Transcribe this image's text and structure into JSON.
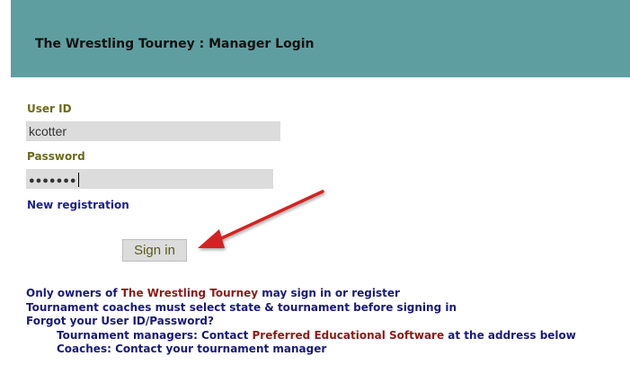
{
  "header": {
    "title": "The Wrestling Tourney : Manager Login"
  },
  "form": {
    "user_id_label": "User ID",
    "user_id_value": "kcotter",
    "password_label": "Password",
    "password_masked": "●●●●●●●",
    "new_registration": "New registration",
    "sign_in_label": "Sign in"
  },
  "notes": {
    "line1_pre": "Only owners of ",
    "line1_highlight": "The Wrestling Tourney",
    "line1_post": " may sign in or register",
    "line2": "Tournament coaches must select state & tournament before signing in",
    "line3": "Forgot your User ID/Password?",
    "line4_pre": "Tournament managers: Contact ",
    "line4_highlight": "Preferred Educational Software",
    "line4_post": " at the address below",
    "line5": "Coaches: Contact your tournament manager"
  },
  "annotation": {
    "arrow_color": "#d42020"
  }
}
